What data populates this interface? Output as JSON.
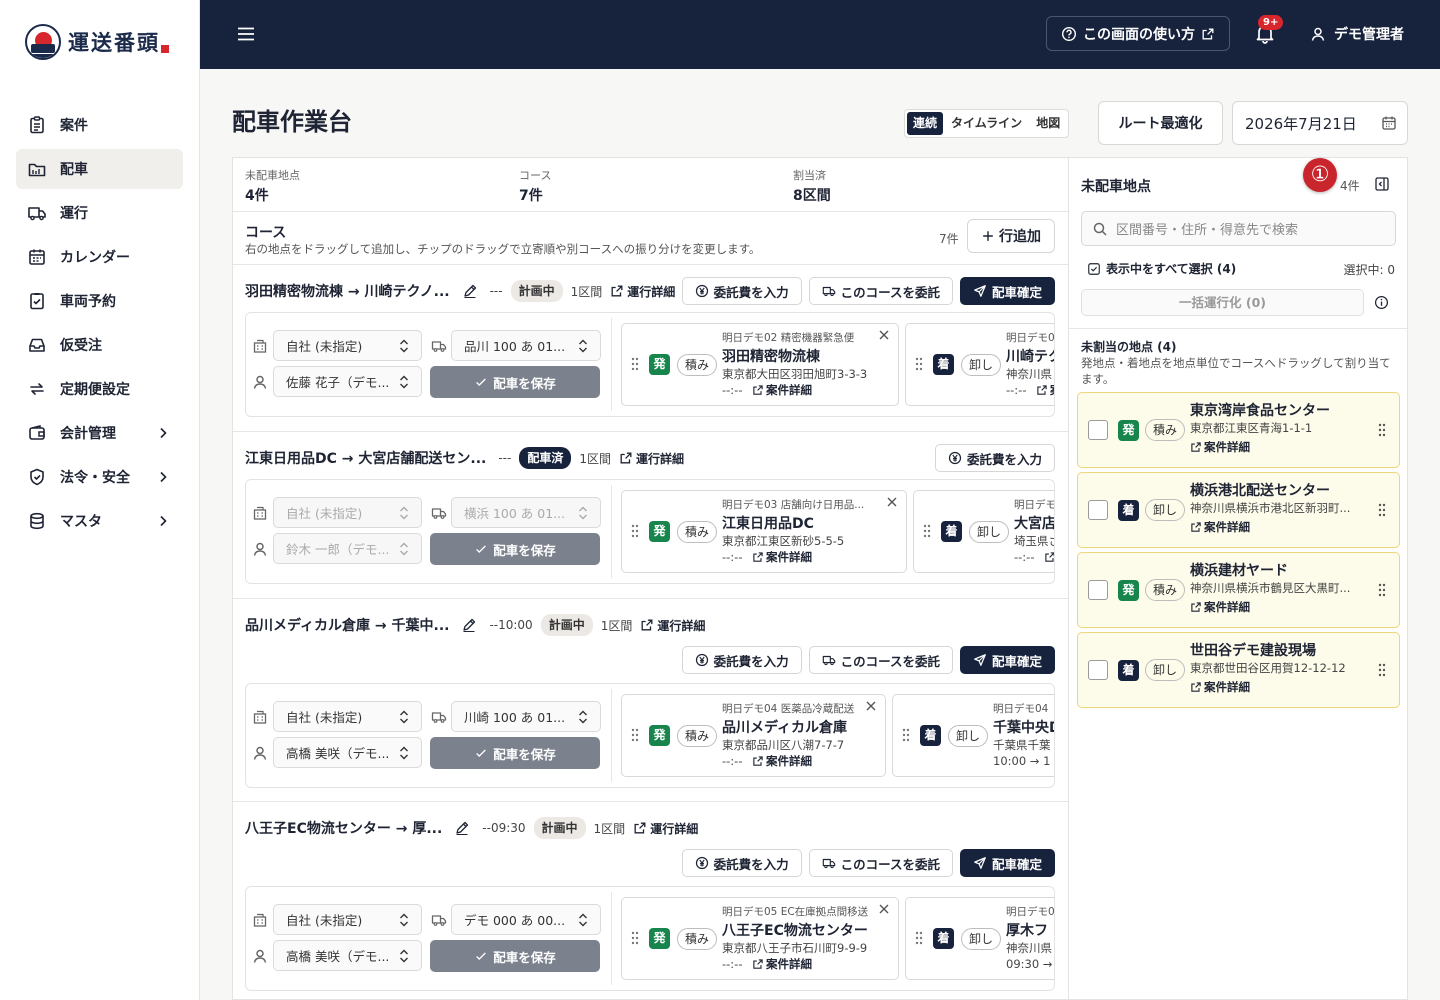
{
  "app": {
    "logo_text": "運送番頭"
  },
  "sidebar": {
    "items": [
      {
        "label": "案件",
        "icon": "clipboard-icon"
      },
      {
        "label": "配車",
        "icon": "truck-folder-icon"
      },
      {
        "label": "運行",
        "icon": "truck-icon"
      },
      {
        "label": "カレンダー",
        "icon": "calendar-icon"
      },
      {
        "label": "車両予約",
        "icon": "clipboard-check-icon"
      },
      {
        "label": "仮受注",
        "icon": "inbox-icon"
      },
      {
        "label": "定期便設定",
        "icon": "repeat-icon"
      },
      {
        "label": "会計管理",
        "icon": "wallet-icon"
      },
      {
        "label": "法令・安全",
        "icon": "shield-icon"
      },
      {
        "label": "マスタ",
        "icon": "database-icon"
      }
    ],
    "active": "配車"
  },
  "topbar": {
    "help": "この画面の使い方",
    "bell_badge": "9+",
    "user": "デモ管理者"
  },
  "page": {
    "title": "配車作業台",
    "views": [
      "連続",
      "タイムライン",
      "地図"
    ],
    "view_selected": "連続",
    "optimize": "ルート最適化",
    "date": "2026年7月21日"
  },
  "stats": [
    {
      "label": "未配車地点",
      "value": "4件"
    },
    {
      "label": "コース",
      "value": "7件"
    },
    {
      "label": "割当済",
      "value": "8区間"
    }
  ],
  "course_header": {
    "title": "コース",
    "desc": "右の地点をドラッグして追加し、チップのドラッグで立寄順や別コースへの振り分けを変更します。",
    "count": "7件",
    "add": "行追加"
  },
  "labels": {
    "run_detail": "運行詳細",
    "fee": "委託費を入力",
    "delegate": "このコースを委託",
    "confirm": "配車確定",
    "save": "配車を保存",
    "case_detail": "案件詳細",
    "dep": "発",
    "arr": "着",
    "load": "積み",
    "unload": "卸し"
  },
  "courses": [
    {
      "name": "羽田精密物流棟 → 川崎テクノ...",
      "time": "---",
      "status": "計画中",
      "segments": "1区間",
      "carrier": "自社 (未指定)",
      "vehicle": "品川 100 あ 01...",
      "driver": "佐藤 花子（デモ...",
      "stops": [
        {
          "ref": "明日デモ02 精密機器緊急便",
          "name": "羽田精密物流棟",
          "addr": "東京都大田区羽田旭町3-3-3",
          "time": "--:--"
        },
        {
          "ref": "明日デモ0",
          "name": "川崎テクノ",
          "addr": "神奈川県",
          "time": "--:--"
        }
      ]
    },
    {
      "name": "江東日用品DC → 大宮店舗配送セン...",
      "time": "---",
      "status": "配車済",
      "segments": "1区間",
      "carrier": "自社 (未指定)",
      "vehicle": "横浜 100 あ 01...",
      "driver": "鈴木 一郎（デモ...",
      "stops": [
        {
          "ref": "明日デモ03 店舗向け日用品...",
          "name": "江東日用品DC",
          "addr": "東京都江東区新砂5-5-5",
          "time": "--:--"
        },
        {
          "ref": "明日デモ",
          "name": "大宮店",
          "addr": "埼玉県さ",
          "time": "--:--"
        }
      ]
    },
    {
      "name": "品川メディカル倉庫 → 千葉中...",
      "time": "--10:00",
      "status": "計画中",
      "segments": "1区間",
      "carrier": "自社 (未指定)",
      "vehicle": "川崎 100 あ 01...",
      "driver": "高橋 美咲（デモ...",
      "stops": [
        {
          "ref": "明日デモ04 医薬品冷蔵配送",
          "name": "品川メディカル倉庫",
          "addr": "東京都品川区八潮7-7-7",
          "time": "--:--"
        },
        {
          "ref": "明日デモ04",
          "name": "千葉中央D",
          "addr": "千葉県千葉",
          "time": "10:00 → 1"
        }
      ]
    },
    {
      "name": "八王子EC物流センター → 厚...",
      "time": "--09:30",
      "status": "計画中",
      "segments": "1区間",
      "carrier": "自社 (未指定)",
      "vehicle": "デモ 000 あ 00...",
      "driver": "高橋 美咲（デモ...",
      "stops": [
        {
          "ref": "明日デモ05 EC在庫拠点間移送",
          "name": "八王子EC物流センター",
          "addr": "東京都八王子市石川町9-9-9",
          "time": "--:--"
        },
        {
          "ref": "明日デモ0",
          "name": "厚木フ",
          "addr": "神奈川県",
          "time": "09:30 → "
        }
      ]
    }
  ],
  "right": {
    "title": "未配車地点",
    "badge": "①",
    "count": "4件",
    "search_placeholder": "区間番号・住所・得意先で検索",
    "select_all": "表示中をすべて選択 (4)",
    "selected": "選択中: 0",
    "bulk": "一括運行化 (0)",
    "sub": "未割当の地点 (4)",
    "desc": "発地点・着地点を地点単位でコースへドラッグして割り当てます。",
    "items": [
      {
        "kind": "発",
        "act": "積み",
        "name": "東京湾岸食品センター",
        "addr": "東京都江東区青海1-1-1"
      },
      {
        "kind": "着",
        "act": "卸し",
        "name": "横浜港北配送センター",
        "addr": "神奈川県横浜市港北区新羽町..."
      },
      {
        "kind": "発",
        "act": "積み",
        "name": "横浜建材ヤード",
        "addr": "神奈川県横浜市鶴見区大黒町..."
      },
      {
        "kind": "着",
        "act": "卸し",
        "name": "世田谷デモ建設現場",
        "addr": "東京都世田谷区用賀12-12-12"
      }
    ]
  },
  "colors": {
    "navy": "#17223d",
    "dep_green": "#17854c",
    "badge_red": "#c8262c",
    "card_yellow": "#fdfbea"
  }
}
